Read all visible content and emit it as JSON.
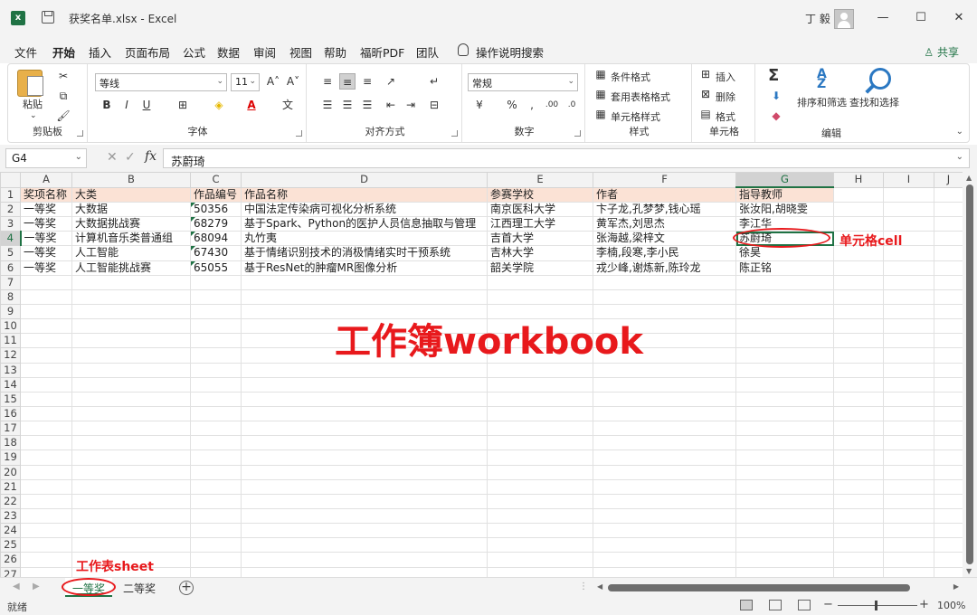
{
  "window": {
    "title": "获奖名单.xlsx  -  Excel",
    "user": "丁 毅",
    "minimize": "—",
    "maximize": "☐",
    "close": "✕"
  },
  "menu": {
    "items": [
      "文件",
      "开始",
      "插入",
      "页面布局",
      "公式",
      "数据",
      "审阅",
      "视图",
      "帮助",
      "福昕PDF",
      "团队",
      "操作说明搜索"
    ],
    "active": "开始",
    "share": "♙ 共享"
  },
  "ribbon": {
    "clipboard": {
      "label": "剪贴板",
      "paste": "粘贴"
    },
    "font": {
      "label": "字体",
      "name": "等线",
      "size": "11",
      "bold": "B",
      "italic": "I",
      "underline": "U"
    },
    "alignment": {
      "label": "对齐方式"
    },
    "number": {
      "label": "数字",
      "format": "常规"
    },
    "styles": {
      "label": "样式",
      "conditional": "条件格式",
      "table": "套用表格格式",
      "cell": "单元格样式"
    },
    "cells": {
      "label": "单元格",
      "insert": "插入",
      "delete": "删除",
      "format": "格式"
    },
    "editing": {
      "label": "编辑",
      "sort": "排序和筛选",
      "find": "查找和选择"
    }
  },
  "formula_bar": {
    "name_box": "G4",
    "fx": "fx",
    "content": "苏蔚琦"
  },
  "grid": {
    "columns": [
      "A",
      "B",
      "C",
      "D",
      "E",
      "F",
      "G",
      "H",
      "I",
      "J"
    ],
    "row_count": 27,
    "selected_column": "G",
    "selected_row": 4,
    "rows": [
      [
        "奖项名称",
        "大类",
        "作品编号",
        "作品名称",
        "参赛学校",
        "作者",
        "指导教师",
        "",
        "",
        ""
      ],
      [
        "一等奖",
        "大数据",
        "50356",
        "中国法定传染病可视化分析系统",
        "南京医科大学",
        "卞子龙,孔梦梦,钱心瑶",
        "张汝阳,胡晓雯",
        "",
        "",
        ""
      ],
      [
        "一等奖",
        "大数据挑战赛",
        "68279",
        "基于Spark、Python的医护人员信息抽取与管理",
        "江西理工大学",
        "黄军杰,刘思杰",
        "李江华",
        "",
        "",
        ""
      ],
      [
        "一等奖",
        "计算机音乐类普通组",
        "68094",
        "丸竹夷",
        "吉首大学",
        "张海越,梁梓文",
        "苏蔚琦",
        "",
        "",
        ""
      ],
      [
        "一等奖",
        "人工智能",
        "67430",
        "基于情绪识别技术的消极情绪实时干预系统",
        "吉林大学",
        "李楠,段寒,李小民",
        "徐昊",
        "",
        "",
        ""
      ],
      [
        "一等奖",
        "人工智能挑战赛",
        "65055",
        "基于ResNet的肿瘤MR图像分析",
        "韶关学院",
        "戎少峰,谢炼新,陈玲龙",
        "陈正铭",
        "",
        "",
        ""
      ]
    ]
  },
  "annotations": {
    "workbook": "工作簿workbook",
    "cell": "单元格cell",
    "sheet": "工作表sheet"
  },
  "sheets": {
    "tabs": [
      "一等奖",
      "二等奖"
    ],
    "active": "一等奖",
    "add": "+"
  },
  "status": {
    "text": "就绪",
    "zoom": "100%"
  },
  "colors": {
    "accent": "#1f7244",
    "annotation_red": "#e8191c",
    "header_fill": "#fbe2d5"
  }
}
